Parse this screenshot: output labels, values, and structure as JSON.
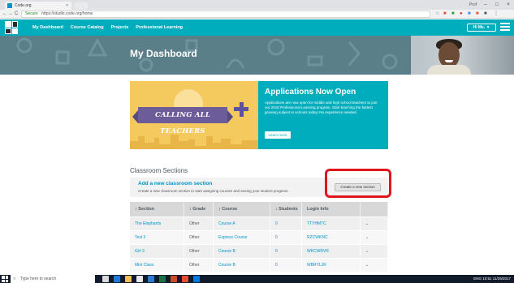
{
  "browser": {
    "tab_title": "Code.org",
    "tab_close": "×",
    "url_secure_label": "Secure",
    "url": "https://studio.code.org/home",
    "back": "←",
    "forward": "→",
    "reload": "C",
    "profile_label": "Prof"
  },
  "site": {
    "nav": [
      "My Dashboard",
      "Course Catalog",
      "Projects",
      "Professional Learning"
    ],
    "signed_in_label": "Hi Ms. ▼"
  },
  "banner": {
    "title": "My Dashboard"
  },
  "card": {
    "ribbon_text": "CALLING ALL TEACHERS",
    "title": "Applications Now Open",
    "body": "Applications are now open for middle and high school teachers to join our 2018 Professional Learning program. Start teaching the fastest growing subject in schools today! No experience needed.",
    "button_label": "Learn more"
  },
  "sections": {
    "heading": "Classroom Sections",
    "add_title": "Add a new classroom section",
    "add_desc": "Create a new classroom section to start assigning courses and seeing your student progress.",
    "create_button": "Create a new section",
    "columns": [
      "Section",
      "Grade",
      "Course",
      "Students",
      "Login Info",
      ""
    ],
    "rows": [
      {
        "section": "The Elephants",
        "grade": "Other",
        "course": "Course A",
        "students": "0",
        "login": "TTYHMTC",
        "expand": "⌄"
      },
      {
        "section": "Test 3",
        "grade": "Other",
        "course": "Express Course",
        "students": "0",
        "login": "RZCWKNC",
        "expand": "⌄"
      },
      {
        "section": "Girl 3",
        "grade": "Other",
        "course": "Course B",
        "students": "0",
        "login": "WKCWRVR",
        "expand": "⌄"
      },
      {
        "section": "Mint Class",
        "grade": "Other",
        "course": "Course B",
        "students": "0",
        "login": "WBRYLJR",
        "expand": "⌄"
      }
    ]
  },
  "taskbar": {
    "search_placeholder": "Type here to search",
    "tray_text": "ENG  10:51  11/29/2017"
  },
  "colors": {
    "brand_teal": "#00adbc",
    "link_blue": "#0094ca",
    "highlight_red": "#e0161c",
    "banner_purple": "#6c5c9a",
    "card_yellow": "#f4c95d"
  }
}
